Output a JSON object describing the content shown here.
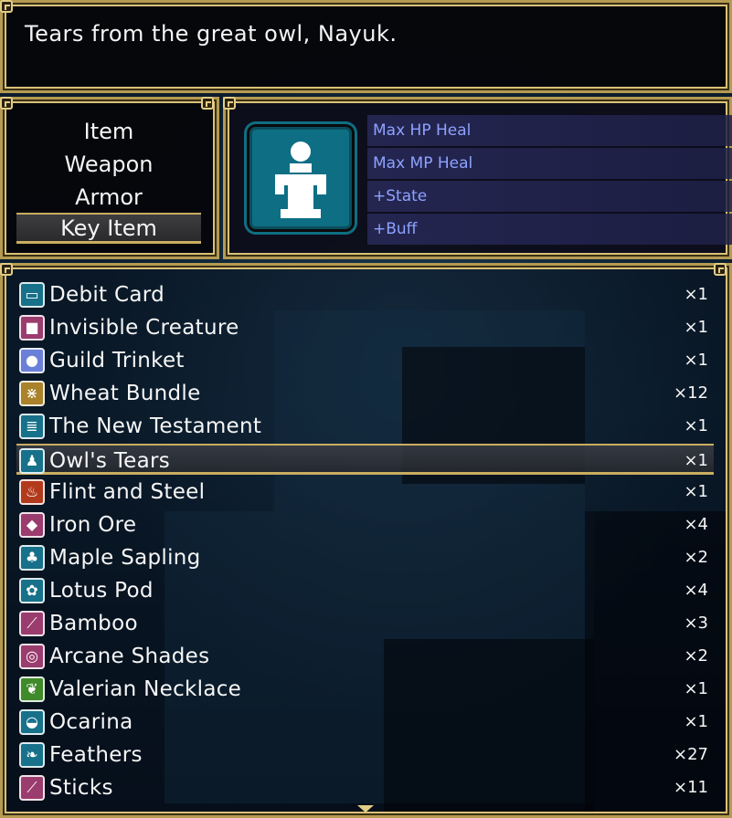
{
  "help": {
    "text": "Tears from the great owl, Nayuk."
  },
  "categories": [
    {
      "label": "Item",
      "selected": false
    },
    {
      "label": "Weapon",
      "selected": false
    },
    {
      "label": "Armor",
      "selected": false
    },
    {
      "label": "Key Item",
      "selected": true
    }
  ],
  "preview": {
    "icon": "owl-tears-icon",
    "icon_color": "#0e6f84",
    "stats": [
      "Max HP Heal",
      "Max MP Heal",
      "+State",
      "+Buff"
    ]
  },
  "items": [
    {
      "name": "Debit Card",
      "qty": "×1",
      "icon": "card-icon",
      "color": "#17718a",
      "glyph": "▭"
    },
    {
      "name": "Invisible Creature",
      "qty": "×1",
      "icon": "box-icon",
      "color": "#9a3c6e",
      "glyph": "■"
    },
    {
      "name": "Guild Trinket",
      "qty": "×1",
      "icon": "orb-icon",
      "color": "#6a80d8",
      "glyph": "●"
    },
    {
      "name": "Wheat Bundle",
      "qty": "×12",
      "icon": "wheat-icon",
      "color": "#a9822a",
      "glyph": "⋇"
    },
    {
      "name": "The New Testament",
      "qty": "×1",
      "icon": "book-icon",
      "color": "#17718a",
      "glyph": "≣"
    },
    {
      "name": "Owl's Tears",
      "qty": "×1",
      "icon": "owl-tears-icon",
      "color": "#17718a",
      "glyph": "♟",
      "selected": true
    },
    {
      "name": "Flint and Steel",
      "qty": "×1",
      "icon": "fire-icon",
      "color": "#b23a1c",
      "glyph": "♨"
    },
    {
      "name": "Iron Ore",
      "qty": "×4",
      "icon": "ore-icon",
      "color": "#9a3c6e",
      "glyph": "◆"
    },
    {
      "name": "Maple Sapling",
      "qty": "×2",
      "icon": "sapling-icon",
      "color": "#17718a",
      "glyph": "♣"
    },
    {
      "name": "Lotus Pod",
      "qty": "×4",
      "icon": "leaf-icon",
      "color": "#17718a",
      "glyph": "✿"
    },
    {
      "name": "Bamboo",
      "qty": "×3",
      "icon": "bamboo-icon",
      "color": "#9a3c6e",
      "glyph": "⟋"
    },
    {
      "name": "Arcane Shades",
      "qty": "×2",
      "icon": "shades-icon",
      "color": "#9a3c6e",
      "glyph": "◎"
    },
    {
      "name": "Valerian Necklace",
      "qty": "×1",
      "icon": "necklace-icon",
      "color": "#3f8a2a",
      "glyph": "❦"
    },
    {
      "name": "Ocarina",
      "qty": "×1",
      "icon": "ocarina-icon",
      "color": "#17718a",
      "glyph": "◒"
    },
    {
      "name": "Feathers",
      "qty": "×27",
      "icon": "feather-icon",
      "color": "#17718a",
      "glyph": "❧"
    },
    {
      "name": "Sticks",
      "qty": "×11",
      "icon": "sticks-icon",
      "color": "#9a3c6e",
      "glyph": "⟋"
    }
  ]
}
